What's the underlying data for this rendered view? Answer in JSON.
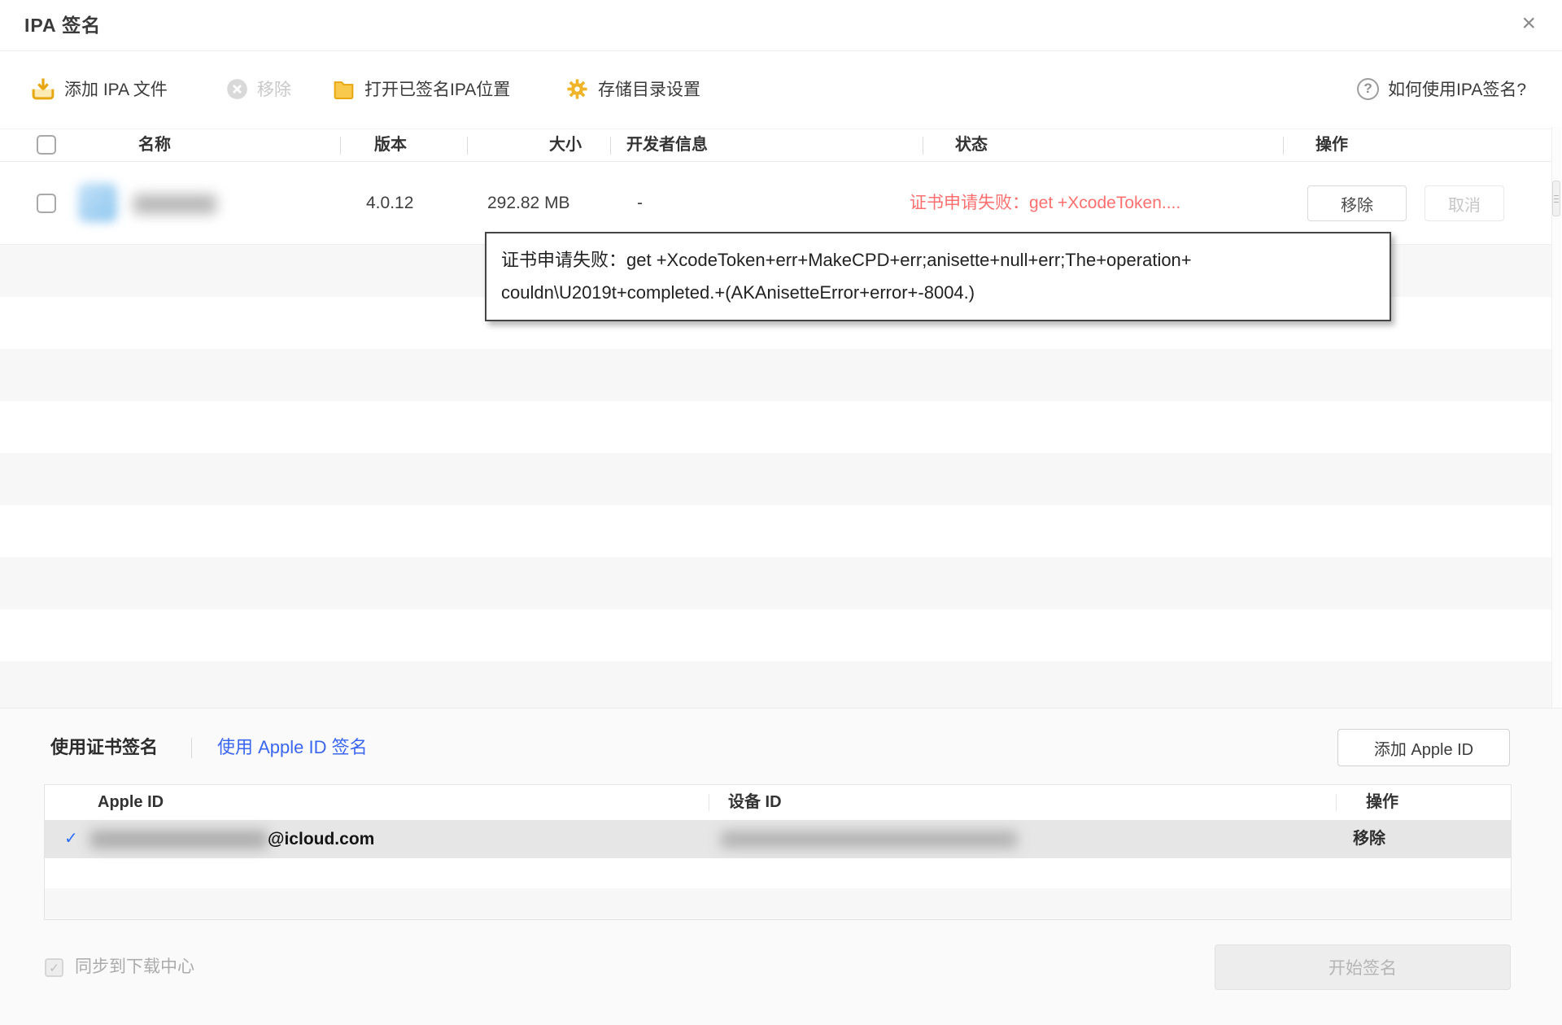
{
  "title_bar": {
    "title": "IPA 签名",
    "close_glyph": "×"
  },
  "toolbar": {
    "add_ipa_label": "添加 IPA 文件",
    "remove_label": "移除",
    "open_signed_location_label": "打开已签名IPA位置",
    "storage_settings_label": "存储目录设置",
    "help_label": "如何使用IPA签名?",
    "help_glyph": "?"
  },
  "ipa_table": {
    "columns": [
      "名称",
      "版本",
      "大小",
      "开发者信息",
      "状态",
      "操作"
    ],
    "row": {
      "version": "4.0.12",
      "size": "292.82 MB",
      "developer": "-",
      "status": "证书申请失败：get +XcodeToken....",
      "remove_button": "移除",
      "cancel_button": "取消"
    }
  },
  "error_tooltip": {
    "line1": "证书申请失败：get +XcodeToken+err+MakeCPD+err;anisette+null+err;The+operation+",
    "line2": "couldn\\U2019t+completed.+(AKAnisetteError+error+-8004.)"
  },
  "signing_panel": {
    "tab_certificate": "使用证书签名",
    "tab_apple_id": "使用 Apple ID 签名",
    "add_apple_id_button": "添加 Apple ID",
    "apple_table": {
      "columns": [
        "Apple ID",
        "设备 ID",
        "操作"
      ],
      "row": {
        "check_glyph": "✓",
        "email_suffix": "@icloud.com",
        "remove_action": "移除"
      }
    },
    "sync_checkbox_label": "同步到下载中心",
    "sync_check_glyph": "✓",
    "start_button": "开始签名"
  },
  "colors": {
    "accent_yellow": "#f0b429",
    "error_red": "#ff6f6f",
    "link_blue": "#3a66f0",
    "check_blue": "#2a6df4"
  }
}
